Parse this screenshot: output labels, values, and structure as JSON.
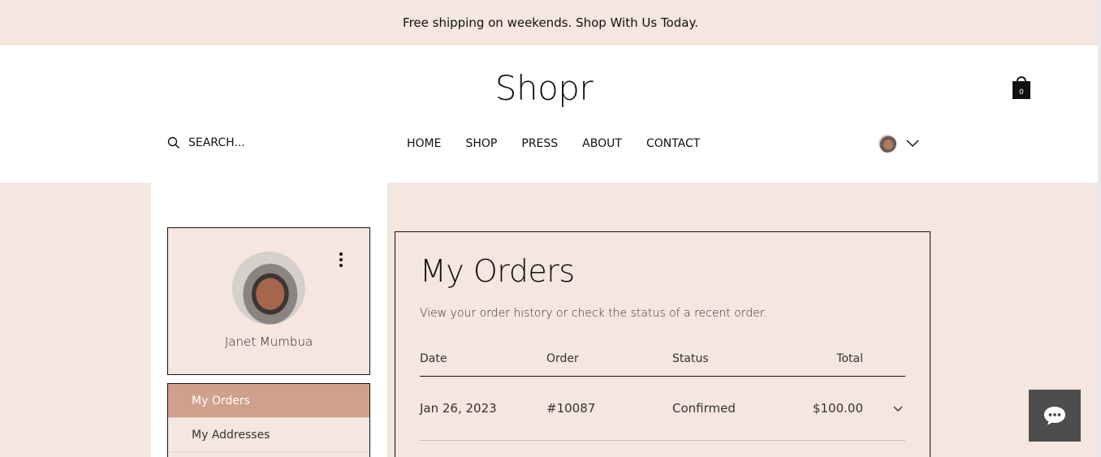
{
  "announcement": "Free shipping on weekends. Shop With Us Today.",
  "logo": "Shopr",
  "cart": {
    "count": "0"
  },
  "search": {
    "placeholder": "SEARCH..."
  },
  "nav": [
    "HOME",
    "SHOP",
    "PRESS",
    "ABOUT",
    "CONTACT"
  ],
  "profile": {
    "name": "Janet Mumbua"
  },
  "account_menu": [
    "My Orders",
    "My Addresses"
  ],
  "orders": {
    "title": "My Orders",
    "subtitle": "View your order history or check the status of a recent order.",
    "columns": {
      "date": "Date",
      "order": "Order",
      "status": "Status",
      "total": "Total"
    },
    "rows": [
      {
        "date": "Jan 26, 2023",
        "order": "#10087",
        "status": "Confirmed",
        "total": "$100.00"
      }
    ]
  },
  "colors": {
    "background": "#f5e6e0",
    "accent": "#cfa08c",
    "chat": "#4d4d4d"
  }
}
